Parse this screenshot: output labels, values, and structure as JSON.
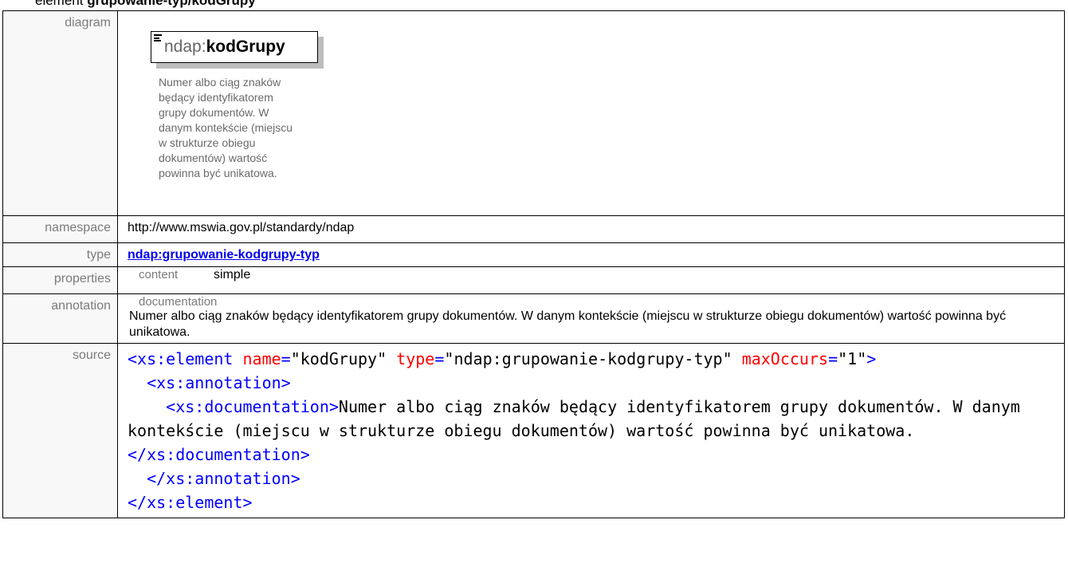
{
  "heading": {
    "prefix": "element ",
    "name": "grupowanie-typ/kodGrupy"
  },
  "rows": {
    "diagram": {
      "label": "diagram",
      "prefix": "ndap:",
      "element_name": "kodGrupy",
      "doc_lines": [
        "Numer albo ciąg znaków",
        "będący identyfikatorem",
        "grupy dokumentów. W",
        "danym kontekście (miejscu",
        "w strukturze obiegu",
        "dokumentów) wartość",
        "powinna być unikatowa."
      ]
    },
    "namespace": {
      "label": "namespace",
      "value": "http://www.mswia.gov.pl/standardy/ndap"
    },
    "type": {
      "label": "type",
      "value": "ndap:grupowanie-kodgrupy-typ"
    },
    "properties": {
      "label": "properties",
      "key": "content",
      "value": "simple"
    },
    "annotation": {
      "label": "annotation",
      "key": "documentation",
      "value": "Numer albo ciąg znaków będący identyfikatorem grupy dokumentów. W danym kontekście (miejscu w strukturze obiegu dokumentów) wartość powinna być unikatowa."
    },
    "source": {
      "label": "source",
      "open_tag": "<xs:element",
      "attr_name": "name",
      "attr_name_value": "\"kodGrupy\"",
      "attr_type": "type",
      "attr_type_value": "\"ndap:grupowanie-kodgrupy-typ\"",
      "attr_max": "maxOccurs",
      "attr_max_value": "\"1\"",
      "open_tag_end": ">",
      "annotation_open": "<xs:annotation>",
      "documentation_open": "<xs:documentation>",
      "documentation_text": "Numer albo ciąg znaków będący identyfikatorem grupy dokumentów. W danym kontekście (miejscu w strukturze obiegu dokumentów) wartość powinna być unikatowa.",
      "documentation_close": "</xs:documentation>",
      "annotation_close": "</xs:annotation>",
      "element_close": "</xs:element>"
    }
  },
  "colors": {
    "label_gray": "#7b7b7b",
    "link_blue": "#0000ee",
    "xml_tag": "#0000ff",
    "xml_attr": "#ff0000"
  }
}
